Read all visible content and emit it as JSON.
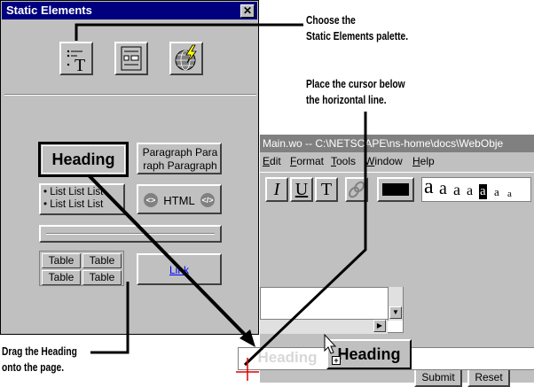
{
  "palette": {
    "title": "Static Elements",
    "close_glyph": "✕",
    "tools": [
      {
        "icon": "static-text-icon"
      },
      {
        "icon": "form-icon"
      },
      {
        "icon": "globe-lightning-icon"
      }
    ],
    "heading_label": "Heading",
    "paragraph_label": "Paragraph Paragraph Paragraph",
    "paragraph_lines": [
      "Paragraph Para",
      "raph Paragraph"
    ],
    "list_lines": [
      "• List List List",
      "• List List List"
    ],
    "html_label": "HTML",
    "table_cells": [
      "Table",
      "Table",
      "Table",
      "Table"
    ],
    "link_label": "Link"
  },
  "editor": {
    "title": "Main.wo  --  C:\\NETSCAPE\\ns-home\\docs\\WebObje",
    "menus": [
      {
        "mnemonic": "E",
        "rest": "dit"
      },
      {
        "mnemonic": "F",
        "rest": "ormat"
      },
      {
        "mnemonic": "T",
        "rest": "ools"
      },
      {
        "mnemonic": "W",
        "rest": "indow"
      },
      {
        "mnemonic": "H",
        "rest": "elp"
      }
    ],
    "toolbar": {
      "italic": "I",
      "underline": "U",
      "teletype": "T",
      "font_sizes": [
        "a",
        "a",
        "a",
        "a",
        "a",
        "a",
        "a"
      ]
    },
    "submit_label": "Submit",
    "reset_label": "Reset",
    "drop_ghost_label": "Heading",
    "dragged_label": "Heading",
    "accent_titlebar": "#00007f",
    "inactive_titlebar": "#808080"
  },
  "callouts": {
    "choose_palette": [
      "Choose the",
      "Static Elements palette."
    ],
    "place_cursor": [
      "Place the cursor below",
      "the horizontal line."
    ],
    "drag_heading": [
      "Drag the Heading",
      "onto the page."
    ]
  }
}
